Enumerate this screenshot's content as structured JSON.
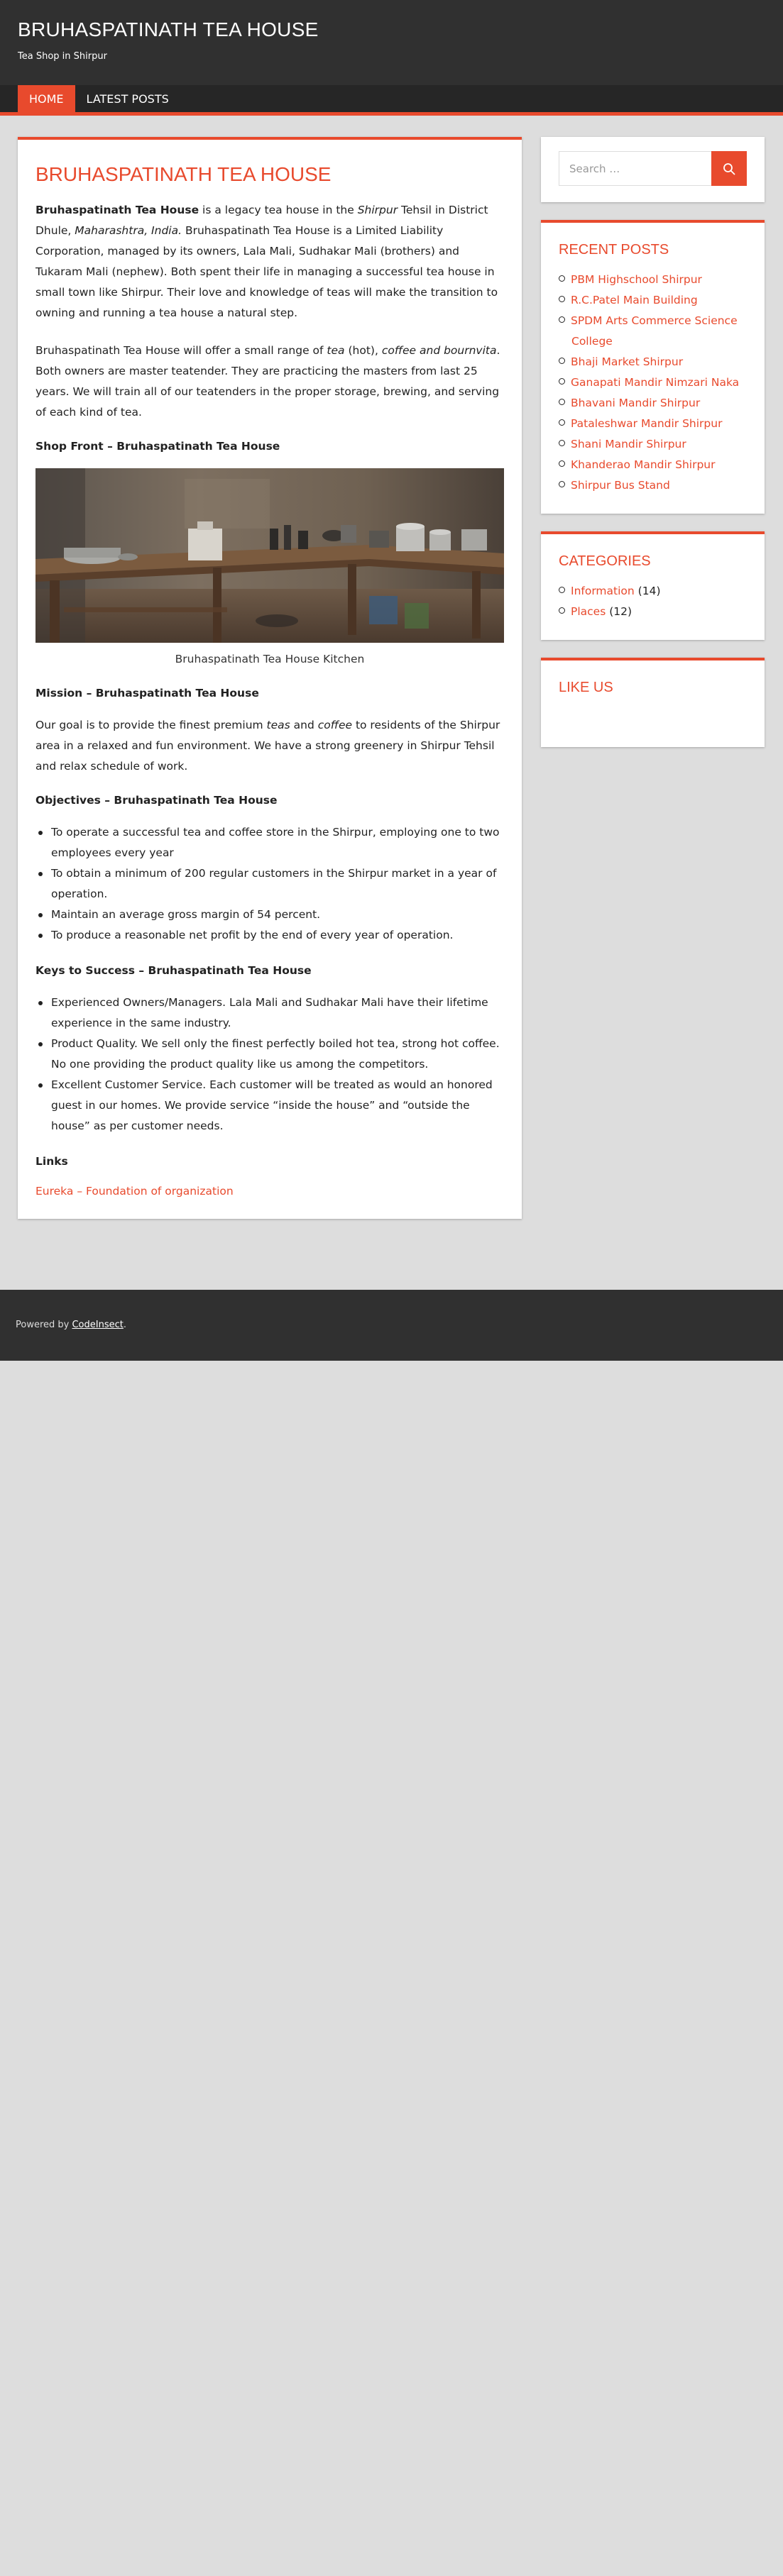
{
  "header": {
    "site_title": "BRUHASPATINATH TEA HOUSE",
    "site_description": "Tea Shop in Shirpur"
  },
  "nav": {
    "items": [
      {
        "label": "HOME",
        "active": true
      },
      {
        "label": "LATEST POSTS",
        "active": false
      }
    ]
  },
  "article": {
    "title": "BRUHASPATINATH TEA HOUSE",
    "intro": {
      "bold": "Bruhaspatinath Tea House",
      "t1": " is a legacy tea house in the ",
      "i1": "Shirpur",
      "t2": " Tehsil in District Dhule, ",
      "i2": "Maharashtra, India.",
      "t3": " Bruhaspatinath Tea House is a Limited Liability Corporation, managed by its owners, Lala Mali, Sudhakar Mali (brothers) and Tukaram Mali (nephew). Both spent their life in managing a successful tea house in small town like Shirpur. Their love and knowledge of teas will make the transition to owning and running a tea house a natural step."
    },
    "offer": {
      "t1": "Bruhaspatinath Tea House will offer a small range of ",
      "i1": "tea",
      "t2": " (hot), ",
      "i2": "coffee and bournvita",
      "t3": ". Both owners are master teatender. They are practicing the masters from last 25 years. We will train all of our teatenders in the proper storage, brewing, and serving of each kind of tea."
    },
    "shop_front_heading": "Shop Front – Bruhaspatinath Tea House",
    "photo_caption": "Bruhaspatinath Tea House Kitchen",
    "mission_heading": "Mission – Bruhaspatinath Tea House",
    "mission": {
      "t1": "Our goal is to provide the finest premium ",
      "i1": "teas",
      "t2": " and ",
      "i2": "coffee",
      "t3": " to residents of the Shirpur area in a relaxed and fun environment. We have a strong greenery in Shirpur Tehsil and relax schedule of work."
    },
    "objectives_heading": "Objectives – Bruhaspatinath Tea House",
    "objectives": [
      "To  operate a successful tea and coffee store in the Shirpur, employing one to two employees every year",
      "To obtain a minimum of 200 regular customers in the Shirpur market in a year of operation.",
      "Maintain an average gross margin of 54 percent.",
      "To produce a reasonable net profit by the end of every year of operation."
    ],
    "keys_heading": "Keys to Success – Bruhaspatinath Tea House",
    "keys": [
      "Experienced Owners/Managers. Lala Mali and Sudhakar Mali have their lifetime experience in the same industry.",
      "Product Quality. We sell only the finest perfectly boiled hot tea, strong hot coffee. No one providing the product quality like us among the competitors.",
      "Excellent Customer Service. Each customer will be treated as would an honored guest in our homes. We provide service “inside the house” and “outside the house” as per customer needs."
    ],
    "links_heading": "Links",
    "link_text": "Eureka – Foundation of organization"
  },
  "sidebar": {
    "search_placeholder": "Search …",
    "recent_posts_title": "RECENT POSTS",
    "recent_posts": [
      "PBM Highschool Shirpur",
      "R.C.Patel Main Building",
      "SPDM Arts Commerce Science College",
      "Bhaji Market Shirpur",
      "Ganapati Mandir Nimzari Naka",
      "Bhavani Mandir Shirpur",
      "Pataleshwar Mandir Shirpur",
      "Shani Mandir Shirpur",
      "Khanderao Mandir Shirpur",
      "Shirpur Bus Stand"
    ],
    "categories_title": "CATEGORIES",
    "categories": [
      {
        "name": "Information",
        "count": "(14)"
      },
      {
        "name": "Places",
        "count": "(12)"
      }
    ],
    "likeus_title": "LIKE US"
  },
  "footer": {
    "prefix": "Powered by ",
    "link": "CodeInsect",
    "suffix": "."
  },
  "colors": {
    "accent": "#e84a2d",
    "header_bg": "#303030",
    "nav_bg": "#262626",
    "page_bg": "#dddddd"
  },
  "icons": {
    "search_button": "search-icon"
  }
}
